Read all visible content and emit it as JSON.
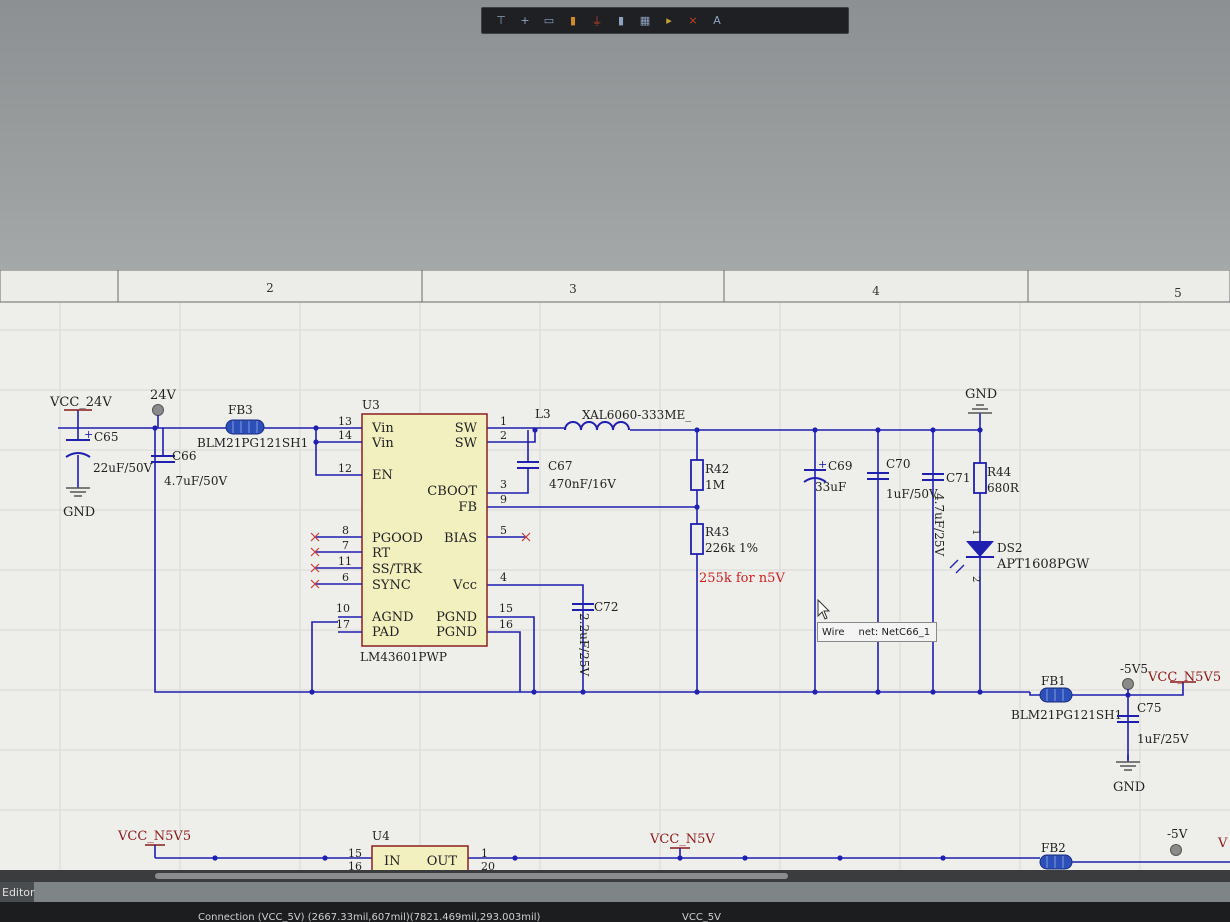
{
  "toolbar": {
    "icons": [
      "filter-icon",
      "place-wire-icon",
      "place-bus-icon",
      "place-port-icon",
      "place-power-icon",
      "place-part-icon",
      "place-sheet-icon",
      "place-netlabel-icon",
      "no-erc-icon",
      "text-icon"
    ],
    "glyphs": [
      "⊤",
      "+",
      "▭",
      "▮",
      "⏚",
      "▮",
      "▦",
      "▸",
      "⨯",
      "A"
    ]
  },
  "ruler": {
    "zones": [
      "2",
      "3",
      "4",
      "5"
    ]
  },
  "schematic": {
    "nets": {
      "vcc_24v": "VCC_24V",
      "p24v": "24V",
      "gnd1": "GND",
      "gnd2": "GND",
      "gnd3": "GND",
      "m5v5": "-5V5",
      "vcc_n5v5_a": "VCC_N5V5",
      "vcc_n5v5_b": "VCC_N5V5",
      "vcc_n5v": "VCC_N5V",
      "m5v": "-5V",
      "v_cut": "V"
    },
    "parts": {
      "c65": {
        "ref": "C65",
        "value": "22uF/50V"
      },
      "c66": {
        "ref": "C66",
        "value": "4.7uF/50V"
      },
      "fb3": {
        "ref": "FB3",
        "value": "BLM21PG121SH1"
      },
      "u3": {
        "ref": "U3",
        "value": "LM43601PWP"
      },
      "l3": {
        "ref": "L3",
        "value": "XAL6060-333ME_"
      },
      "c67": {
        "ref": "C67",
        "value": "470nF/16V"
      },
      "r42": {
        "ref": "R42",
        "value": "1M"
      },
      "r43": {
        "ref": "R43",
        "value": "226k 1%"
      },
      "c69": {
        "ref": "C69",
        "value": "33uF"
      },
      "c70": {
        "ref": "C70",
        "value": "1uF/50V"
      },
      "c71": {
        "ref": "C71",
        "value": "4.7uF/25V"
      },
      "r44": {
        "ref": "R44",
        "value": "680R"
      },
      "ds2": {
        "ref": "DS2",
        "value": "APT1608PGW"
      },
      "c72": {
        "ref": "C72",
        "value": "2.2uF/25V"
      },
      "fb1": {
        "ref": "FB1",
        "value": "BLM21PG121SH1"
      },
      "c75": {
        "ref": "C75",
        "value": "1uF/25V"
      },
      "u4": {
        "ref": "U4"
      },
      "fb2": {
        "ref": "FB2"
      }
    },
    "u3_pins": {
      "vin1": "Vin",
      "vin2": "Vin",
      "en": "EN",
      "sw1": "SW",
      "sw2": "SW",
      "cboot": "CBOOT",
      "fb": "FB",
      "pgood": "PGOOD",
      "rt": "RT",
      "ss": "SS/TRK",
      "sync": "SYNC",
      "bias": "BIAS",
      "vcc": "Vcc",
      "agnd": "AGND",
      "pad": "PAD",
      "pgnd1": "PGND",
      "pgnd2": "PGND"
    },
    "u3_pin_numbers": {
      "p13": "13",
      "p14": "14",
      "p12": "12",
      "p8": "8",
      "p7": "7",
      "p11": "11",
      "p6": "6",
      "p10": "10",
      "p17": "17",
      "p1": "1",
      "p2": "2",
      "p3": "3",
      "p9": "9",
      "p5": "5",
      "p4": "4",
      "p15": "15",
      "p16": "16"
    },
    "ds2_pins": {
      "p1": "1",
      "p2": "2"
    },
    "u4_pins": {
      "in": "IN",
      "out": "OUT",
      "p15": "15",
      "p16": "16",
      "p1": "1",
      "p20": "20"
    },
    "annotation": "255k for n5V",
    "colors": {
      "wire": "#1f1fb0",
      "label": "#222222",
      "netname": "#8a1a1a",
      "annotation": "#cc1f1f",
      "ic_fill": "#f2f0bf",
      "ic_stroke": "#8a2020",
      "bead": "#2d4fb8",
      "grid": "#d8d8d4",
      "sheet": "#eeeeea"
    }
  },
  "tooltip": {
    "type": "Wire",
    "net": "net: NetC66_1"
  },
  "panel": {
    "tab": "Editor"
  },
  "status": {
    "connection": "Connection (VCC_5V) (2667.33mil,607mil)(7821.469mil,293.003mil)",
    "net": "VCC_5V"
  }
}
